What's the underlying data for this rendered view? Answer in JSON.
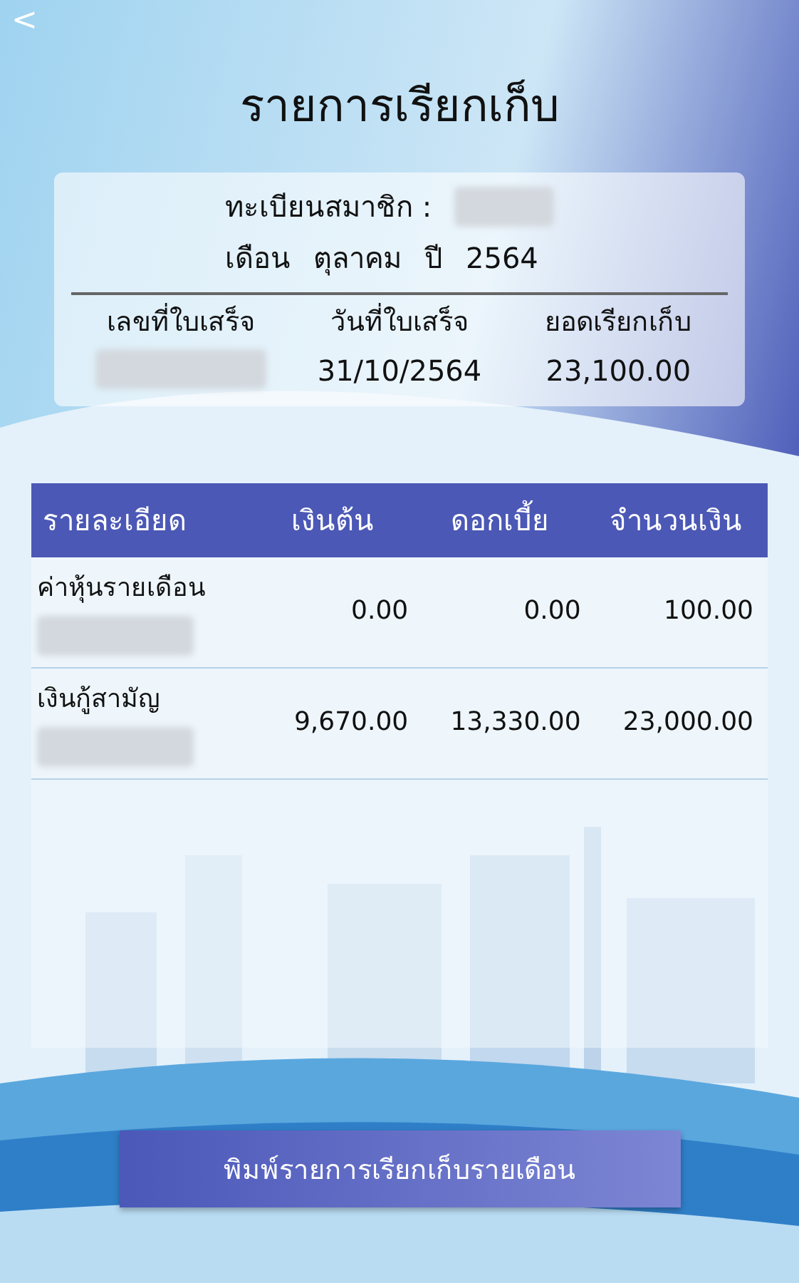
{
  "back": "<",
  "title": "รายการเรียกเก็บ",
  "member": {
    "label": "ทะเบียนสมาชิก :",
    "month_label": "เดือน",
    "month": "ตุลาคม",
    "year_label": "ปี",
    "year": "2564"
  },
  "receipt": {
    "columns": [
      {
        "label": "เลขที่ใบเสร็จ"
      },
      {
        "label": "วันที่ใบเสร็จ",
        "value": "31/10/2564"
      },
      {
        "label": "ยอดเรียกเก็บ",
        "value": "23,100.00"
      }
    ]
  },
  "table": {
    "columns": [
      "รายละเอียด",
      "เงินต้น",
      "ดอกเบี้ย",
      "จำนวนเงิน"
    ],
    "rows": [
      {
        "name": "ค่าหุ้นรายเดือน",
        "principal": "0.00",
        "interest": "0.00",
        "amount": "100.00"
      },
      {
        "name": "เงินกู้สามัญ",
        "principal": "9,670.00",
        "interest": "13,330.00",
        "amount": "23,000.00"
      }
    ]
  },
  "print_button": "พิมพ์รายการเรียกเก็บรายเดือน"
}
